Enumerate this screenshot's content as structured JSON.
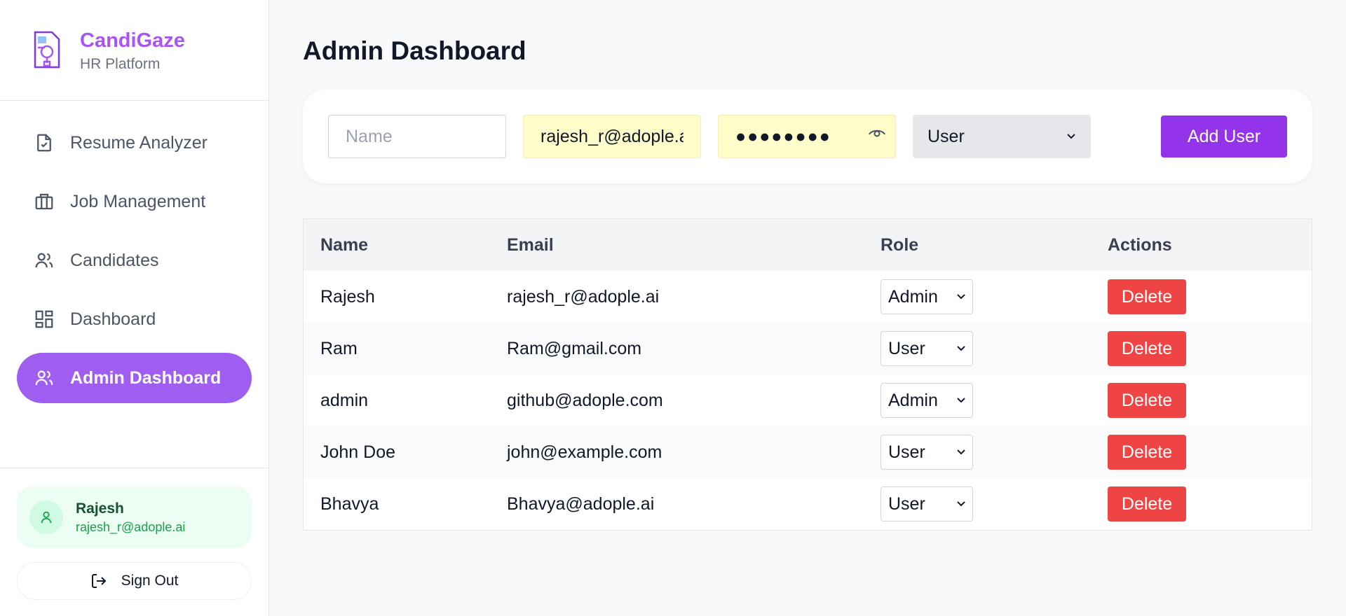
{
  "brand": {
    "name": "CandiGaze",
    "subtitle": "HR Platform",
    "logo_icon": "document-search-icon"
  },
  "sidebar": {
    "items": [
      {
        "label": "Resume Analyzer",
        "icon": "file-icon",
        "active": false
      },
      {
        "label": "Job Management",
        "icon": "briefcase-icon",
        "active": false
      },
      {
        "label": "Candidates",
        "icon": "users-icon",
        "active": false
      },
      {
        "label": "Dashboard",
        "icon": "grid-icon",
        "active": false
      },
      {
        "label": "Admin Dashboard",
        "icon": "users-icon",
        "active": true
      }
    ],
    "user": {
      "name": "Rajesh",
      "email": "rajesh_r@adople.ai",
      "icon": "user-icon"
    },
    "signout_label": "Sign Out"
  },
  "main": {
    "title": "Admin Dashboard",
    "form": {
      "name_placeholder": "Name",
      "email_value": "rajesh_r@adople.ai",
      "password_value": "●●●●●●●●",
      "role_value": "User",
      "add_label": "Add User"
    },
    "table": {
      "headers": [
        "Name",
        "Email",
        "Role",
        "Actions"
      ],
      "rows": [
        {
          "name": "Rajesh",
          "email": "rajesh_r@adople.ai",
          "role": "Admin",
          "action": "Delete"
        },
        {
          "name": "Ram",
          "email": "Ram@gmail.com",
          "role": "User",
          "action": "Delete"
        },
        {
          "name": "admin",
          "email": "github@adople.com",
          "role": "Admin",
          "action": "Delete"
        },
        {
          "name": "John Doe",
          "email": "john@example.com",
          "role": "User",
          "action": "Delete"
        },
        {
          "name": "Bhavya",
          "email": "Bhavya@adople.ai",
          "role": "User",
          "action": "Delete"
        }
      ]
    }
  },
  "colors": {
    "accent": "#a855f7",
    "active_nav": "#a05ef0",
    "primary_button": "#9333ea",
    "danger": "#ef4444",
    "autofill": "#fefcc8"
  }
}
